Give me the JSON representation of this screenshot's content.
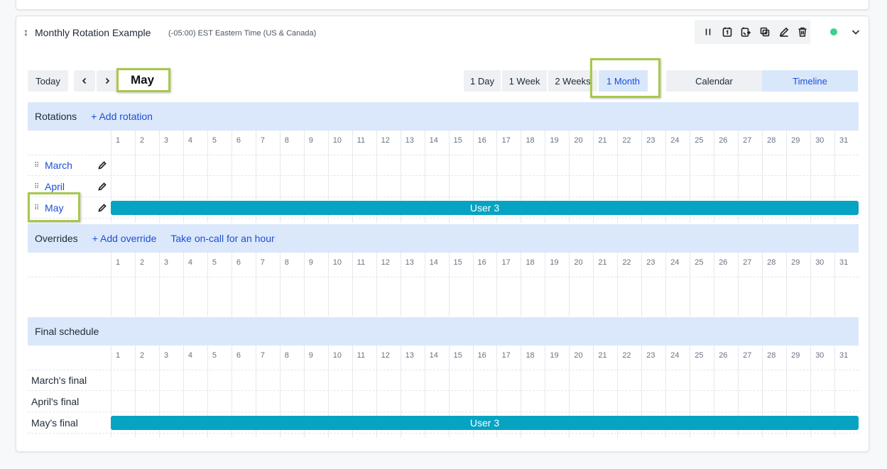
{
  "schedule": {
    "title": "Monthly Rotation Example",
    "timezone": "(-05:00) EST Eastern Time (US & Canada)"
  },
  "toolbar": {
    "today_label": "Today",
    "prev_icon": "chevron-left-icon",
    "next_icon": "chevron-right-icon",
    "month_label": "May",
    "ranges": [
      "1 Day",
      "1 Week",
      "2 Weeks",
      "1 Month"
    ],
    "active_range": "1 Month",
    "views": [
      "Calendar",
      "Timeline"
    ],
    "active_view": "Timeline"
  },
  "actions": [
    "pause-icon",
    "calendar-one-icon",
    "calendar-swap-icon",
    "copy-icon",
    "pencil-icon",
    "trash-icon"
  ],
  "status_color": "#3ecf8e",
  "days": [
    "1",
    "2",
    "3",
    "4",
    "5",
    "6",
    "7",
    "8",
    "9",
    "10",
    "11",
    "12",
    "13",
    "14",
    "15",
    "16",
    "17",
    "18",
    "19",
    "20",
    "21",
    "22",
    "23",
    "24",
    "25",
    "26",
    "27",
    "28",
    "29",
    "30",
    "31"
  ],
  "rotations": {
    "title": "Rotations",
    "add_label": "+ Add rotation",
    "items": [
      {
        "name": "March",
        "user": ""
      },
      {
        "name": "April",
        "user": ""
      },
      {
        "name": "May",
        "user": "User 3"
      }
    ]
  },
  "overrides": {
    "title": "Overrides",
    "add_label": "+ Add override",
    "take_oncall_label": "Take on-call for an hour"
  },
  "final": {
    "title": "Final schedule",
    "items": [
      {
        "name": "March's final",
        "user": ""
      },
      {
        "name": "April's final",
        "user": ""
      },
      {
        "name": "May's final",
        "user": "User 3"
      }
    ]
  },
  "colors": {
    "bar": "#06a3c2",
    "accent": "#1d4ed8",
    "highlight": "#a6c94a",
    "section_bg": "#dbe8fb"
  }
}
